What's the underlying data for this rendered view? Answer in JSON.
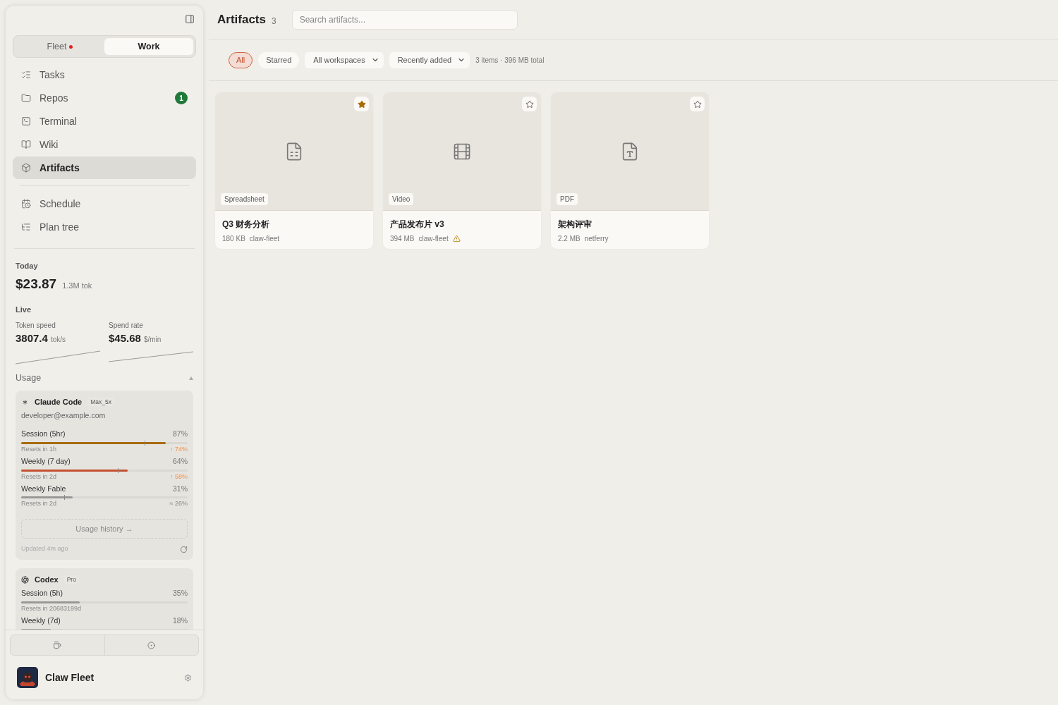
{
  "sidebar": {
    "mode_tabs": [
      {
        "label": "Fleet",
        "selected": false,
        "alert": true
      },
      {
        "label": "Work",
        "selected": true,
        "alert": false
      }
    ],
    "nav": [
      {
        "label": "Tasks",
        "selected": false
      },
      {
        "label": "Repos",
        "selected": false,
        "badge": "1"
      },
      {
        "label": "Terminal",
        "selected": false
      },
      {
        "label": "Wiki",
        "selected": false
      },
      {
        "label": "Artifacts",
        "selected": true
      }
    ],
    "nav_secondary": [
      {
        "label": "Schedule",
        "selected": false
      },
      {
        "label": "Plan tree",
        "selected": false
      }
    ],
    "today": {
      "label": "Today",
      "cost": "$23.87",
      "tokens": "1.3M tok"
    },
    "live": {
      "label": "Live",
      "metrics": [
        {
          "label": "Token speed",
          "value": "3807.4",
          "unit": "tok/s"
        },
        {
          "label": "Spend rate",
          "value": "$45.68",
          "unit": "$/min"
        }
      ]
    },
    "usage": {
      "label": "Usage",
      "expanded": true,
      "accounts": [
        {
          "name": "Claude Code",
          "plan": "Max_5x",
          "email": "developer@example.com",
          "limits": [
            {
              "label": "Session (5hr)",
              "percent": "87%",
              "level": 0.87,
              "color": "#a86b00",
              "marker": {
                "level": 0.74
              },
              "resets": "Resets in 1h",
              "forecast": "↑ 74%",
              "rising": true
            },
            {
              "label": "Weekly (7 day)",
              "percent": "64%",
              "level": 0.64,
              "color": "#c4502f",
              "marker": {
                "level": 0.58
              },
              "resets": "Resets in 2d",
              "forecast": "↑ 58%",
              "rising": true
            },
            {
              "label": "Weekly Fable",
              "percent": "31%",
              "level": 0.31,
              "color": "#9a9896",
              "marker": {
                "level": 0.26
              },
              "resets": "Resets in 2d",
              "forecast": "≈ 26%",
              "rising": false
            }
          ],
          "history_button": "Usage history →",
          "updated": "Updated 4m ago"
        },
        {
          "name": "Codex",
          "plan": "Pro",
          "limits": [
            {
              "label": "Session (5h)",
              "percent": "35%",
              "level": 0.35,
              "color": "#9a9896",
              "resets": "Resets in 20683199d"
            },
            {
              "label": "Weekly (7d)",
              "percent": "18%",
              "level": 0.18,
              "color": "#9a9896"
            }
          ]
        }
      ]
    },
    "footer": {
      "app_name": "Claw Fleet"
    }
  },
  "main": {
    "title": "Artifacts",
    "count": "3",
    "search": {
      "placeholder": "Search artifacts..."
    },
    "filters": [
      {
        "label": "All",
        "selected": true
      },
      {
        "label": "Starred",
        "selected": false
      }
    ],
    "dropdowns": [
      "All workspaces",
      "Recently added"
    ],
    "summary": "3 items · 396 MB total",
    "artifacts": [
      {
        "kind": "spreadsheet",
        "type_label": "Spreadsheet",
        "name": "Q3 财务分析",
        "size": "180 KB",
        "workspace": "claw-fleet",
        "starred": true,
        "warning": false
      },
      {
        "kind": "video",
        "type_label": "Video",
        "name": "产品发布片 v3",
        "size": "394 MB",
        "workspace": "claw-fleet",
        "starred": false,
        "warning": true
      },
      {
        "kind": "document",
        "type_label": "PDF",
        "name": "架构评审",
        "size": "2.2 MB",
        "workspace": "netferry",
        "starred": false,
        "warning": false
      }
    ]
  }
}
